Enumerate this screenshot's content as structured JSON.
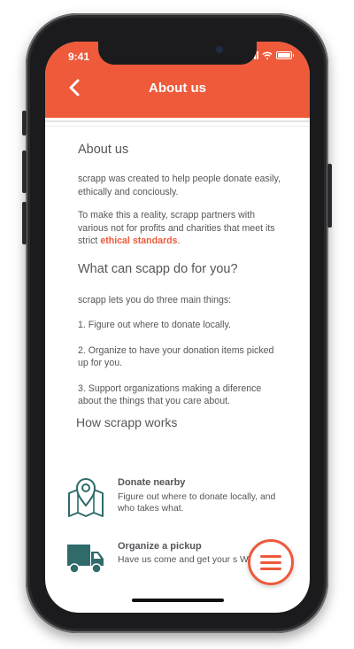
{
  "status_bar": {
    "time": "9:41"
  },
  "header": {
    "title": "About us",
    "back_icon": "chevron-left-icon",
    "color": "#ee5a3a"
  },
  "about": {
    "heading": "About us",
    "para1": "scrapp was created to help people donate easily, ethically and conciously.",
    "para2_prefix": "To make this a reality, scrapp partners with various not for profits and charities that meet its strict ",
    "para2_link": "ethical standards",
    "para2_suffix": "."
  },
  "what": {
    "heading": "What can scapp do for you?",
    "intro": "scrapp lets you do three main things:",
    "item1": "1. Figure out where to donate locally.",
    "item2": "2. Organize to have your donation items picked up for you.",
    "item3": "3. Support organizations making a diference about the things that you care about."
  },
  "how": {
    "heading": "How scrapp works",
    "features": [
      {
        "icon": "map-pin-icon",
        "title": "Donate nearby",
        "desc": "Figure out where to donate locally, and who takes what."
      },
      {
        "icon": "truck-icon",
        "title": "Organize a pickup",
        "desc": "Have us come and get your s We'll make sure it goes to a c you care about."
      }
    ]
  },
  "menu": {
    "icon": "hamburger-menu-icon"
  },
  "colors": {
    "accent": "#ee5a3a",
    "icon_teal": "#2f6b6b",
    "text": "#55565a"
  }
}
